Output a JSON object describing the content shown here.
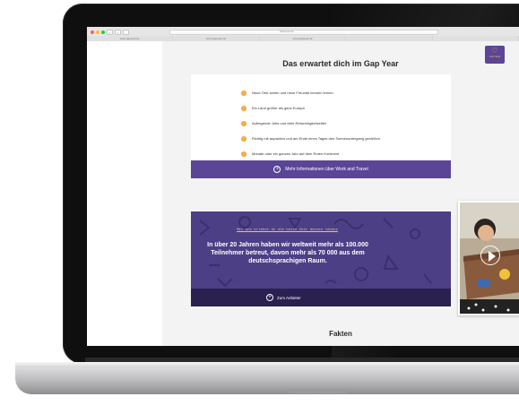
{
  "browser": {
    "address": "GapYear.de",
    "tabs": [
      "www.gapyear.de",
      "www.gapyear.de",
      "www.gapyear.de",
      "",
      ""
    ]
  },
  "logo": {
    "text": "GAPYEAR",
    "icon": "heart-icon",
    "bg": "#5b4597",
    "fg": "#f5b84c"
  },
  "section": {
    "title": "Das erwartet dich im Gap Year",
    "items": [
      "Neue Orte sehen und neue Freunde kennen lernen",
      "Ein Land größer als ganz Europa",
      "Aufregende Jobs und viele Reisemöglichkeiten",
      "Richtig mit anpacken und am Ende eines Tages den Sonnenuntergang genießen",
      "Monate oder ein ganzes Jahr auf dem Roten Kontinent"
    ],
    "more_button": "Mehr Informationen über Work and Travel"
  },
  "promo": {
    "tagline": "Mit uns erlebst du die beste Zeit deines Lebens",
    "headline": "In über 20 Jahren haben wir weltweit mehr als 100.000 Teilnehmer betreut, davon mehr als 70 000 aus dem deutschsprachigen Raum.",
    "button": "Zum Anbieter"
  },
  "facts": {
    "title": "Fakten"
  },
  "colors": {
    "accent": "#5b4597",
    "check": "#f2a53a",
    "tagline": "#f5c25f"
  }
}
